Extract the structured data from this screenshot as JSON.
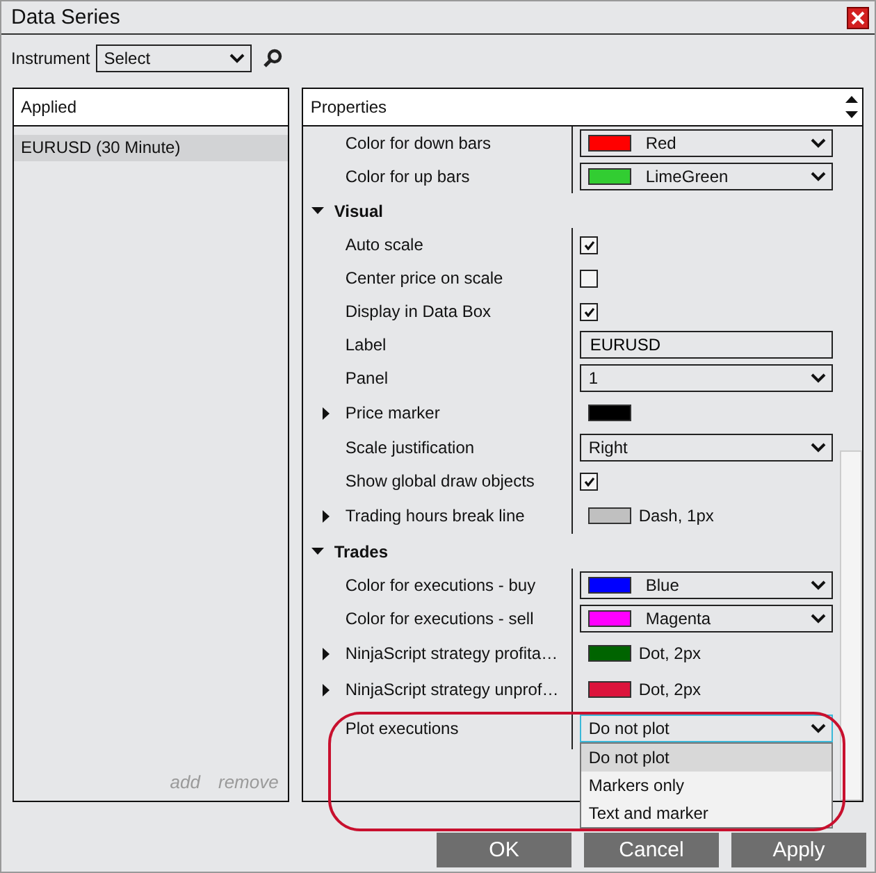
{
  "window": {
    "title": "Data Series"
  },
  "instrument": {
    "label": "Instrument",
    "value": "Select"
  },
  "applied": {
    "header": "Applied",
    "items": [
      {
        "label": "EURUSD (30 Minute)",
        "selected": true
      }
    ],
    "actions": [
      "add",
      "remove"
    ]
  },
  "properties": {
    "header": "Properties",
    "rows": [
      {
        "kind": "color",
        "name": "Color for down bars",
        "value": "Red",
        "color": "#ff0000"
      },
      {
        "kind": "color",
        "name": "Color for up bars",
        "value": "LimeGreen",
        "color": "#32cd32"
      },
      {
        "kind": "category",
        "name": "Visual",
        "expanded": true
      },
      {
        "kind": "checkbox",
        "name": "Auto scale",
        "checked": true
      },
      {
        "kind": "checkbox",
        "name": "Center price on scale",
        "checked": false
      },
      {
        "kind": "checkbox",
        "name": "Display in Data Box",
        "checked": true
      },
      {
        "kind": "text",
        "name": "Label",
        "value": "EURUSD"
      },
      {
        "kind": "select",
        "name": "Panel",
        "value": "1"
      },
      {
        "kind": "stroke",
        "name": "Price marker",
        "color": "#000000",
        "expanded": false
      },
      {
        "kind": "select",
        "name": "Scale justification",
        "value": "Right"
      },
      {
        "kind": "checkbox",
        "name": "Show global draw objects",
        "checked": true
      },
      {
        "kind": "stroke",
        "name": "Trading hours break line",
        "color": "#c0c0c0",
        "value": "Dash, 1px",
        "expanded": false
      },
      {
        "kind": "category",
        "name": "Trades",
        "expanded": true
      },
      {
        "kind": "color",
        "name": "Color for executions - buy",
        "value": "Blue",
        "color": "#0000ff"
      },
      {
        "kind": "color",
        "name": "Color for executions - sell",
        "value": "Magenta",
        "color": "#ff00ff"
      },
      {
        "kind": "stroke",
        "name": "NinjaScript strategy profita…",
        "color": "#006400",
        "value": "Dot, 2px",
        "expanded": false
      },
      {
        "kind": "stroke",
        "name": "NinjaScript strategy unprof…",
        "color": "#dc143c",
        "value": "Dot, 2px",
        "expanded": false
      },
      {
        "kind": "select",
        "name": "Plot executions",
        "value": "Do not plot",
        "open": true,
        "options": [
          {
            "label": "Do not plot",
            "selected": true
          },
          {
            "label": "Markers only",
            "selected": false
          },
          {
            "label": "Text and marker",
            "selected": false
          }
        ]
      }
    ]
  },
  "buttons": [
    "OK",
    "Cancel",
    "Apply"
  ]
}
